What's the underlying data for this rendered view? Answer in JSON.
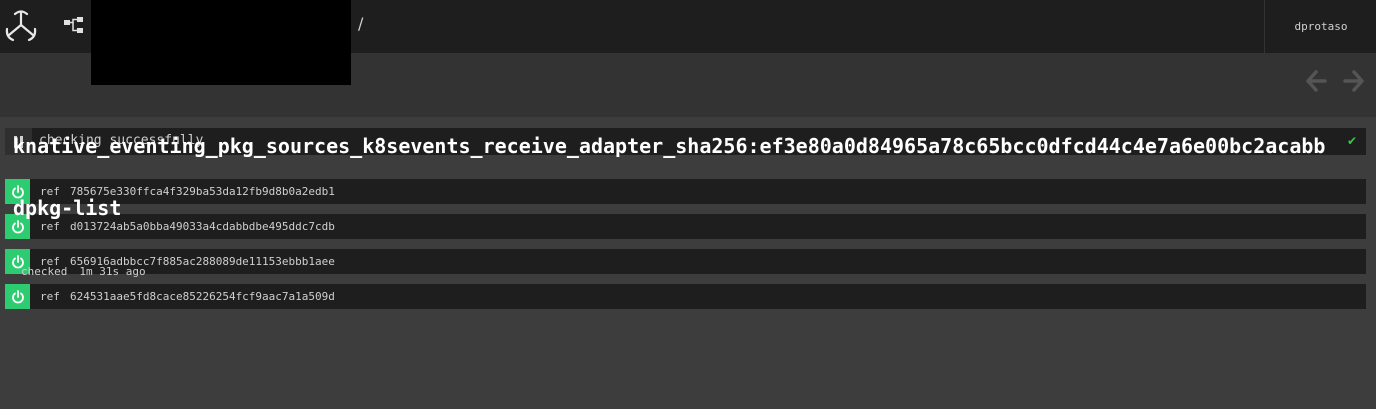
{
  "header": {
    "breadcrumb_separator": "/",
    "user": "dprotaso"
  },
  "nav": {
    "prev_icon": "arrow-left-icon",
    "next_icon": "arrow-right-icon"
  },
  "resource": {
    "status_text": "checking successfully",
    "name": "knative_eventing_pkg_sources_k8sevents_receive_adapter_sha256:ef3e80a0d84965a78c65bcc0dfcd44c4e7a6e00bc2acabb",
    "type": "dpkg-list",
    "checked_label": "checked",
    "checked_ago": "1m 31s ago"
  },
  "versions": [
    {
      "key": "ref",
      "value": "785675e330ffca4f329ba53da12fb9d8b0a2edb1",
      "enabled": true
    },
    {
      "key": "ref",
      "value": "d013724ab5a0bba49033a4cdabbdbe495ddc7cdb",
      "enabled": true
    },
    {
      "key": "ref",
      "value": "656916adbbcc7f885ac288089de11153ebbb1aee",
      "enabled": true
    },
    {
      "key": "ref",
      "value": "624531aae5fd8cace85226254fcf9aac7a1a509d",
      "enabled": true
    }
  ],
  "colors": {
    "enabled_green": "#2ecc71",
    "check_green": "#2ecc40",
    "topbar": "#1e1e1e",
    "background": "#3d3d3d"
  }
}
